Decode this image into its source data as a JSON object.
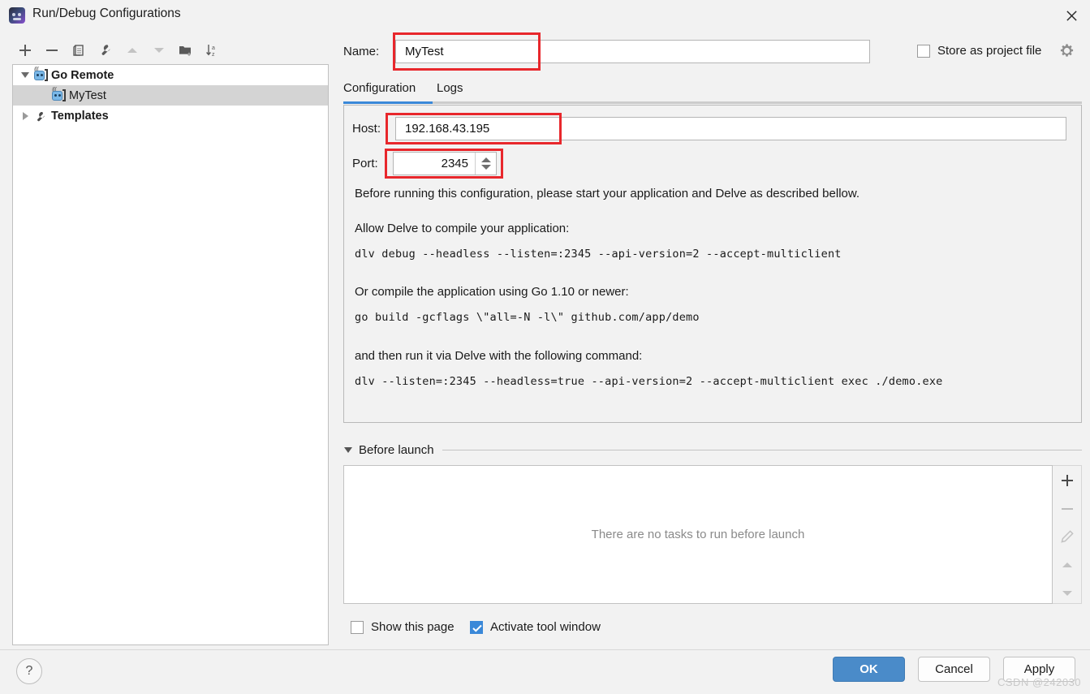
{
  "window": {
    "title": "Run/Debug Configurations",
    "app_icon": "goland-icon",
    "close_icon": "close-icon"
  },
  "tree_toolbar": {
    "buttons": [
      {
        "name": "add-configuration-button",
        "icon": "plus-icon",
        "enabled": true
      },
      {
        "name": "remove-configuration-button",
        "icon": "minus-icon",
        "enabled": true
      },
      {
        "name": "copy-configuration-button",
        "icon": "copy-icon",
        "enabled": true
      },
      {
        "name": "edit-templates-button",
        "icon": "wrench-icon",
        "enabled": true
      },
      {
        "name": "move-up-button",
        "icon": "arrow-up-icon",
        "enabled": false
      },
      {
        "name": "move-down-button",
        "icon": "arrow-down-icon",
        "enabled": false
      },
      {
        "name": "new-folder-button",
        "icon": "new-folder-icon",
        "enabled": true
      },
      {
        "name": "sort-configurations-button",
        "icon": "sort-alpha-icon",
        "enabled": true
      }
    ]
  },
  "tree": {
    "items": [
      {
        "label": "Go Remote",
        "icon": "go-remote-icon",
        "expanded": true,
        "level": 0,
        "bold": true,
        "selected": false
      },
      {
        "label": "MyTest",
        "icon": "go-remote-icon",
        "level": 1,
        "bold": false,
        "selected": true
      },
      {
        "label": "Templates",
        "icon": "wrench-icon",
        "expanded": false,
        "level": 0,
        "bold": true,
        "selected": false
      }
    ]
  },
  "form": {
    "name_label": "Name:",
    "name_value": "MyTest",
    "store_as_project_file_label": "Store as project file",
    "store_as_project_file_checked": false,
    "gear_icon": "gear-dropdown-icon"
  },
  "tabs": {
    "items": [
      {
        "label": "Configuration",
        "active": true
      },
      {
        "label": "Logs",
        "active": false
      }
    ],
    "active_color": "#3a88d8"
  },
  "configuration": {
    "host_label": "Host:",
    "host_value": "192.168.43.195",
    "port_label": "Port:",
    "port_value": "2345",
    "intro": "Before running this configuration, please start your application and Delve as described bellow.",
    "section1_title": "Allow Delve to compile your application:",
    "section1_command": "dlv debug --headless --listen=:2345 --api-version=2 --accept-multiclient",
    "section2_title": "Or compile the application using Go 1.10 or newer:",
    "section2_command": "go build -gcflags \\\"all=-N -l\\\" github.com/app/demo",
    "section3_title": "and then run it via Delve with the following command:",
    "section3_command": "dlv --listen=:2345 --headless=true --api-version=2 --accept-multiclient exec ./demo.exe"
  },
  "before_launch": {
    "title": "Before launch",
    "expanded": true,
    "empty_text": "There are no tasks to run before launch",
    "side_buttons": [
      {
        "name": "add-task-button",
        "icon": "plus-icon",
        "enabled": true
      },
      {
        "name": "remove-task-button",
        "icon": "minus-icon",
        "enabled": false
      },
      {
        "name": "edit-task-button",
        "icon": "pencil-icon",
        "enabled": false
      },
      {
        "name": "move-task-up-button",
        "icon": "arrow-up-icon",
        "enabled": false
      },
      {
        "name": "move-task-down-button",
        "icon": "arrow-down-icon",
        "enabled": false
      }
    ]
  },
  "options": {
    "show_this_page_label": "Show this page",
    "show_this_page_checked": false,
    "activate_tool_window_label": "Activate tool window",
    "activate_tool_window_checked": true
  },
  "footer": {
    "help_label": "?",
    "ok_label": "OK",
    "cancel_label": "Cancel",
    "apply_label": "Apply"
  },
  "watermark": "CSDN @242030",
  "annotations": {
    "highlight_color": "#e8272c",
    "boxes": [
      "name-field",
      "host-field",
      "port-field"
    ]
  }
}
